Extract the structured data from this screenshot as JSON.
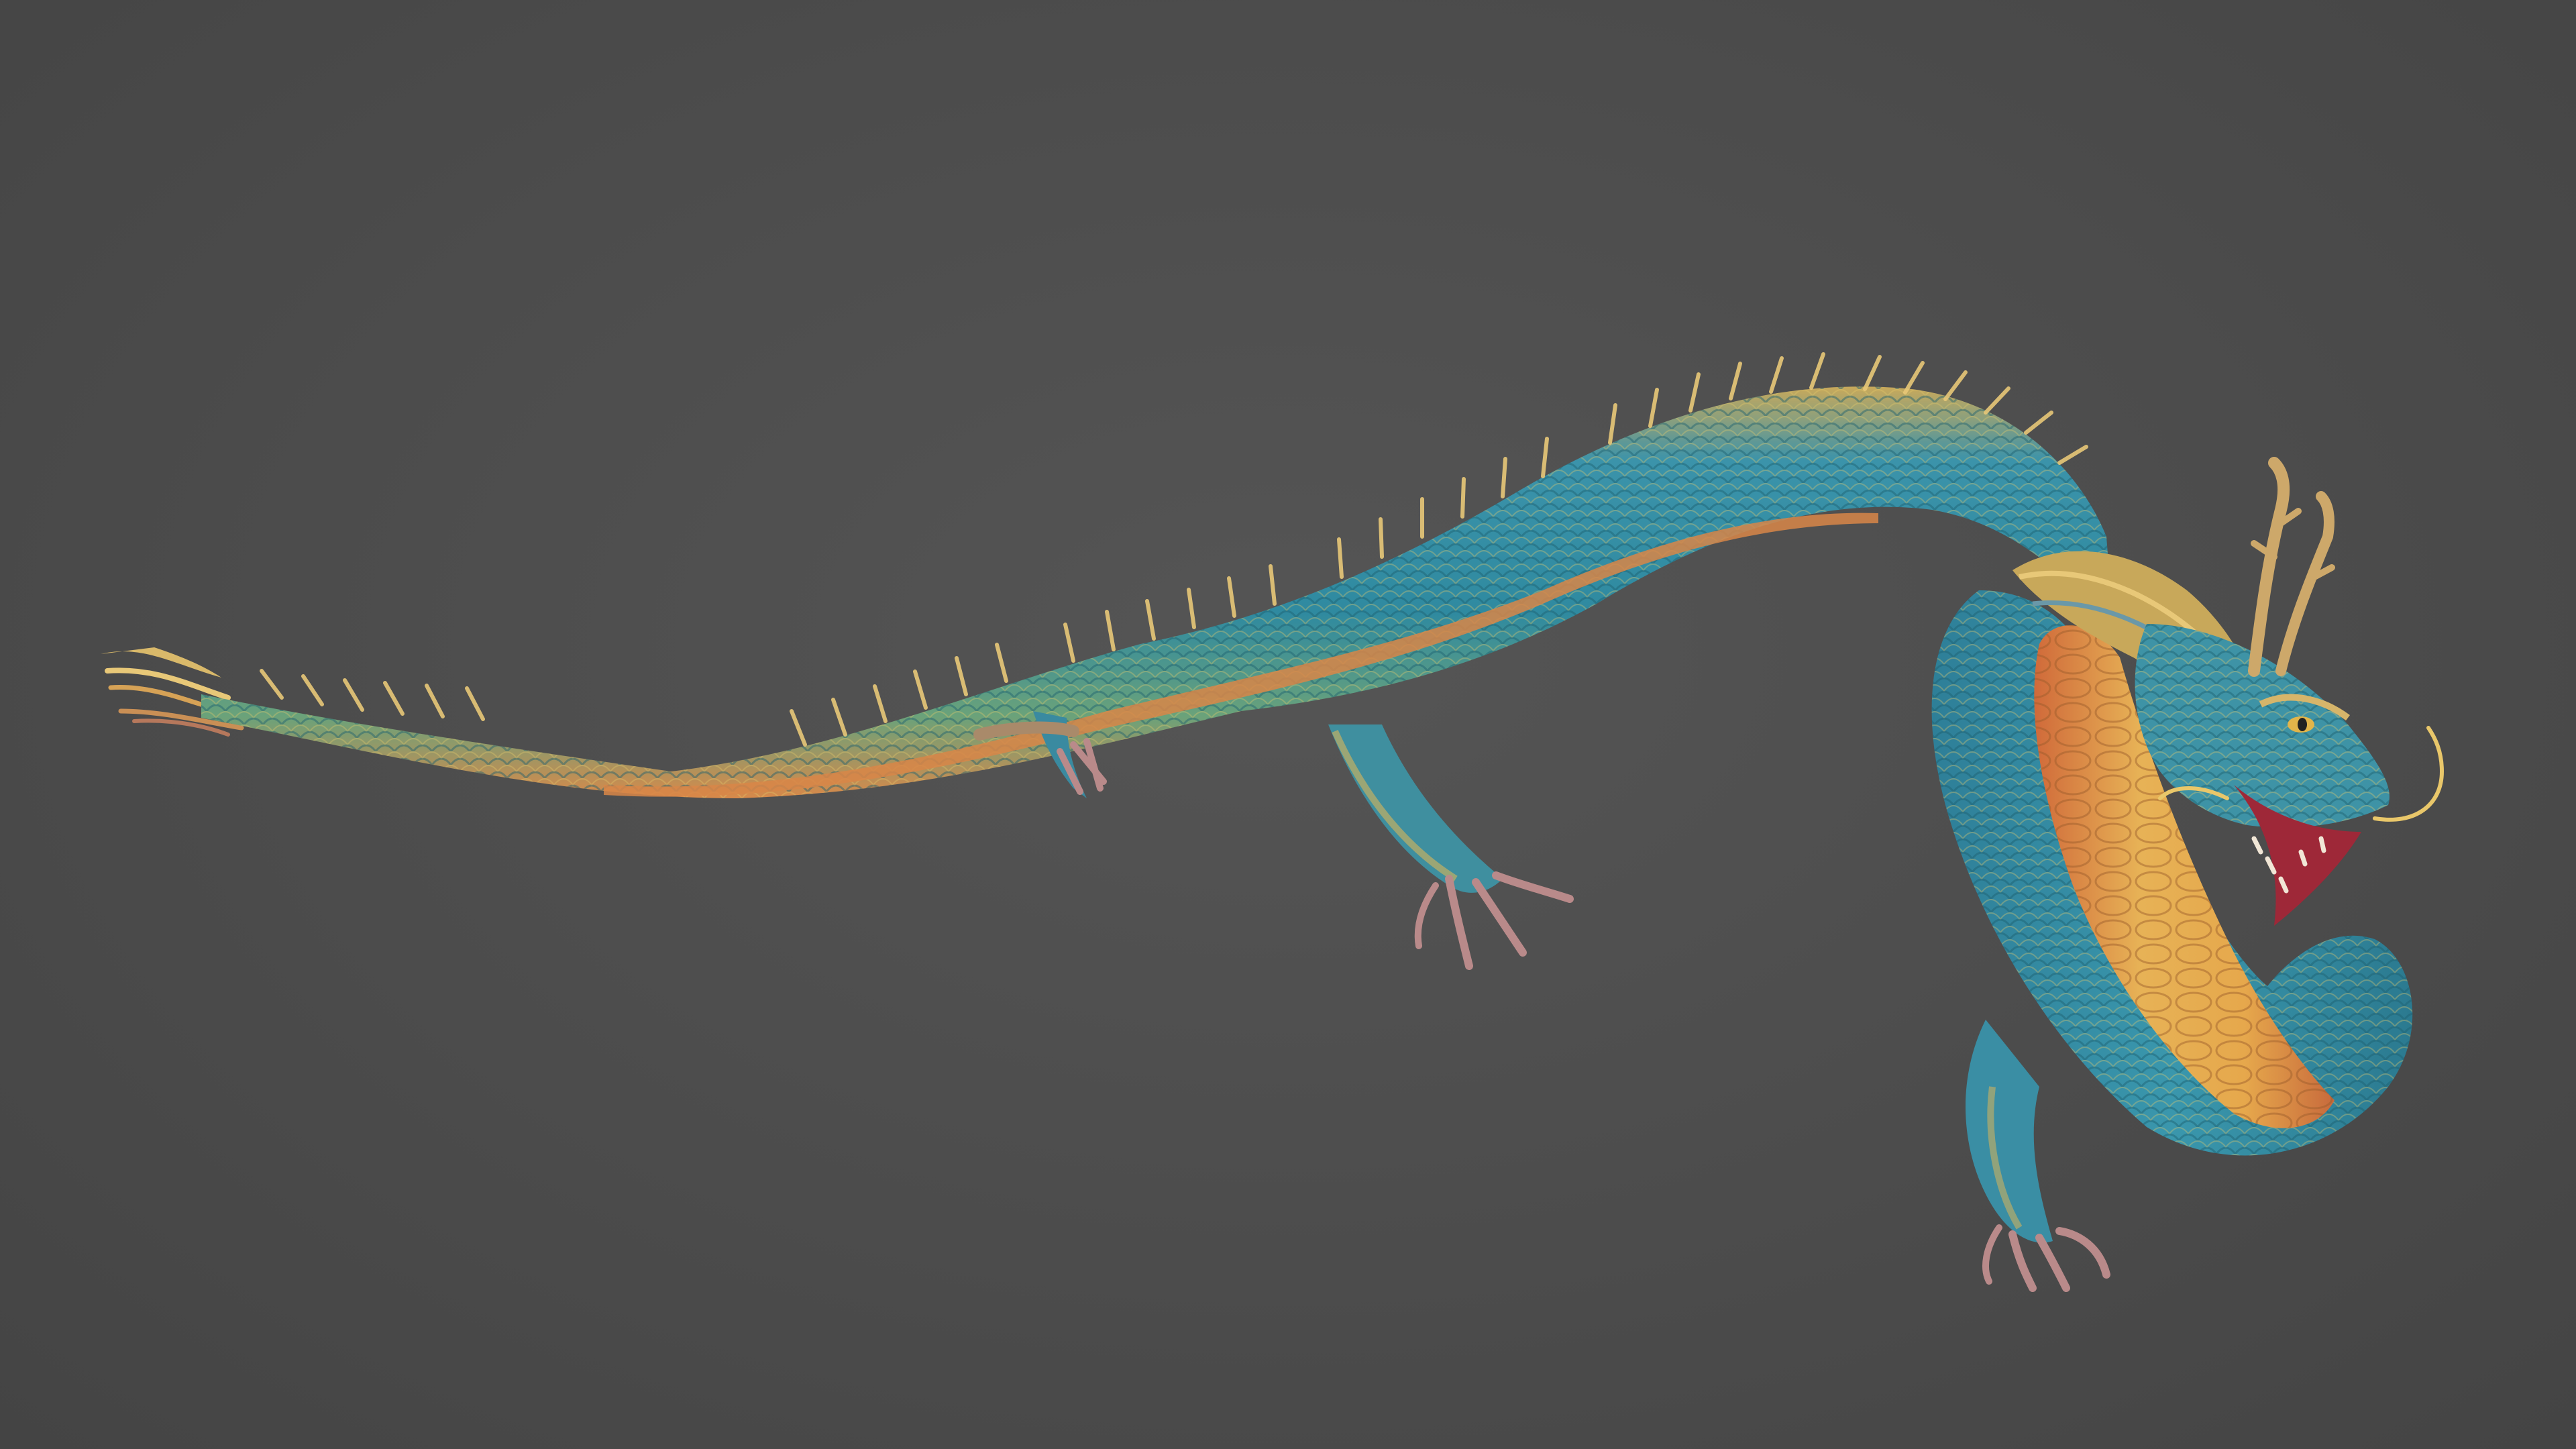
{
  "scene": {
    "subject": "dragon-model",
    "background_color": "#4a4a4a",
    "palette": {
      "body_teal": "#2f8aa0",
      "scale_yellow": "#d9b54a",
      "belly_gold": "#e2a24a",
      "belly_orange": "#d07a3a",
      "spine_gold": "#e8c878",
      "mouth_red": "#9e2838",
      "claw_pink": "#b98a8a",
      "whisker_gold": "#e9c76a"
    }
  }
}
